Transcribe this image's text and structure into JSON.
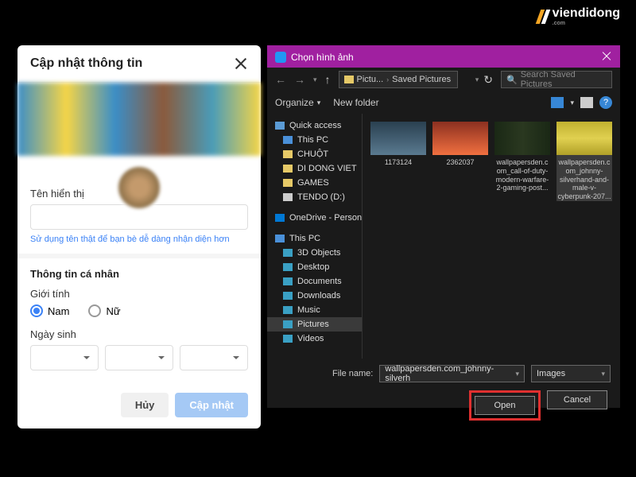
{
  "watermark": {
    "brand": "viendidong",
    "sub": ".com"
  },
  "modal": {
    "title": "Cập nhật thông tin",
    "name_label": "Tên hiển thị",
    "name_hint": "Sử dụng tên thật để bạn bè dễ dàng nhận diện hơn",
    "personal_info": "Thông tin cá nhân",
    "gender_label": "Giới tính",
    "gender_male": "Nam",
    "gender_female": "Nữ",
    "gender_selected": "Nam",
    "dob_label": "Ngày sinh",
    "cancel_btn": "Hủy",
    "update_btn": "Cập nhật"
  },
  "picker": {
    "title": "Chọn hình ảnh",
    "breadcrumb": [
      "Pictu...",
      "Saved Pictures"
    ],
    "search_placeholder": "Search Saved Pictures",
    "organize": "Organize",
    "new_folder": "New folder",
    "sidebar": {
      "quick_access": "Quick access",
      "this_pc_quick": "This PC",
      "folders": [
        "CHUỘT",
        "DI DONG VIET",
        "GAMES",
        "TENDO (D:)"
      ],
      "onedrive": "OneDrive - Person",
      "this_pc": "This PC",
      "this_pc_items": [
        "3D Objects",
        "Desktop",
        "Documents",
        "Downloads",
        "Music",
        "Pictures",
        "Videos"
      ]
    },
    "thumbs": [
      {
        "name": "1173124"
      },
      {
        "name": "2362037"
      },
      {
        "name": "wallpapersden.com_call-of-duty-modern-warfare-2-gaming-post..."
      },
      {
        "name": "wallpapersden.com_johnny-silverhand-and-male-v-cyberpunk-207..."
      }
    ],
    "filename_label": "File name:",
    "filename_value": "wallpapersden.com_johnny-silverh",
    "filter": "Images",
    "open_btn": "Open",
    "cancel_btn": "Cancel"
  }
}
